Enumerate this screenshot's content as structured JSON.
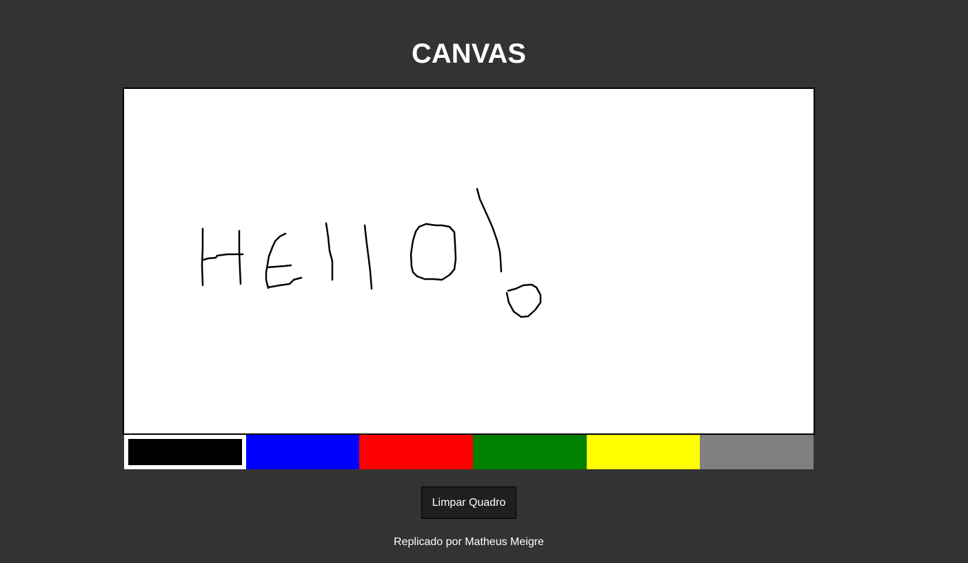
{
  "page": {
    "title": "CANVAS",
    "clear_button_label": "Limpar Quadro",
    "credit": "Replicado por Matheus Meigre"
  },
  "canvas": {
    "background": "#ffffff",
    "stroke_color": "#000000",
    "drawing": "handwritten \"Hello!\" in black strokes"
  },
  "palette": {
    "selected": "black",
    "colors": [
      {
        "name": "black",
        "hex": "#000000"
      },
      {
        "name": "blue",
        "hex": "#0000ff"
      },
      {
        "name": "red",
        "hex": "#ff0000"
      },
      {
        "name": "green",
        "hex": "#008000"
      },
      {
        "name": "yellow",
        "hex": "#ffff00"
      },
      {
        "name": "gray",
        "hex": "#808080"
      }
    ]
  }
}
